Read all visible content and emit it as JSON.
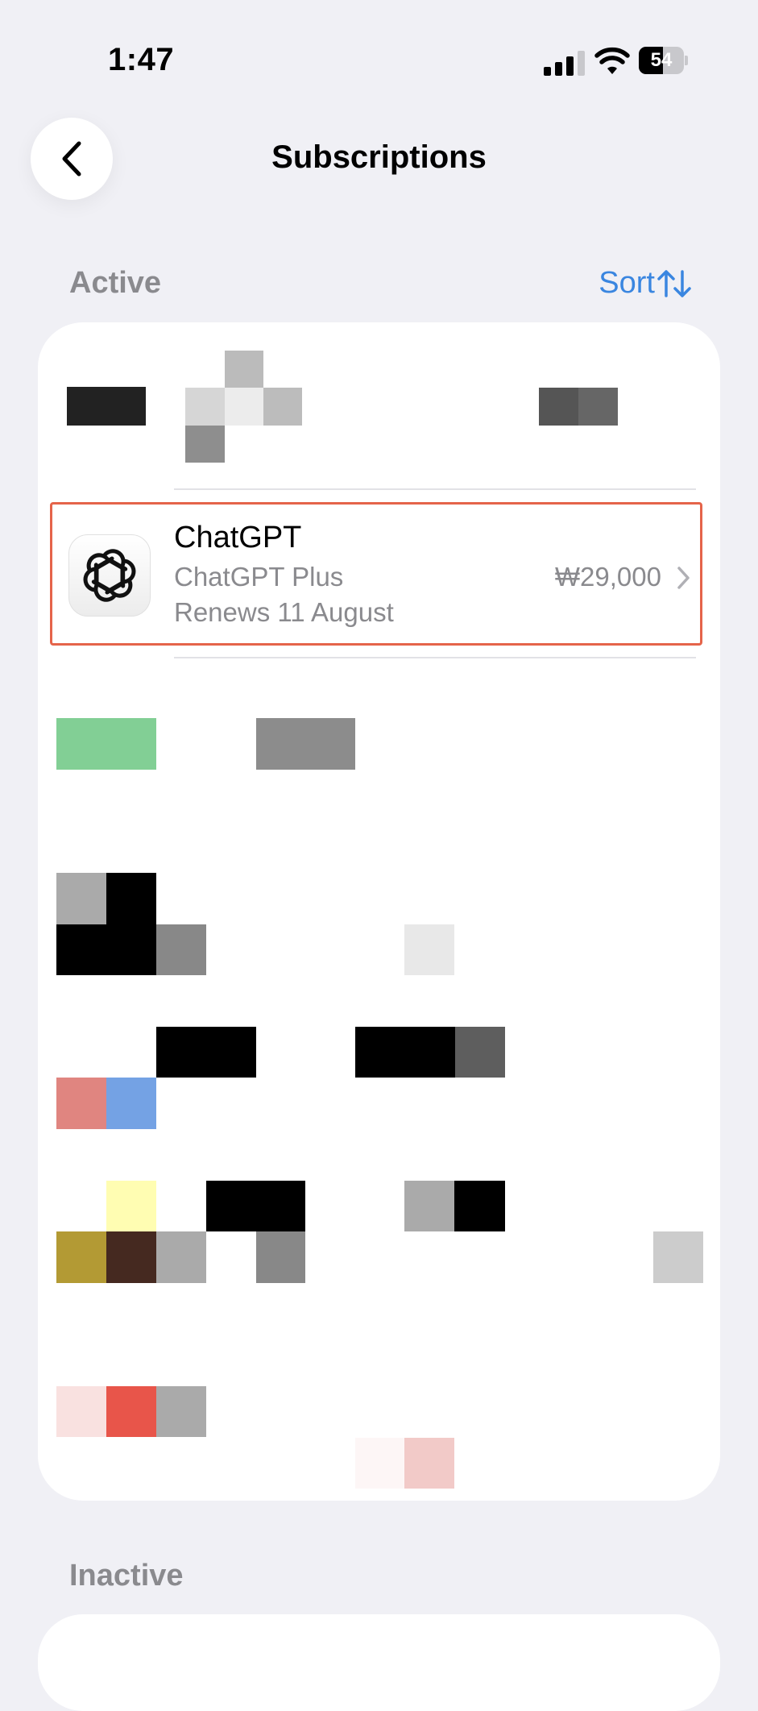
{
  "status_bar": {
    "time": "1:47",
    "battery": "54",
    "battery_level": 0.54
  },
  "nav": {
    "title": "Subscriptions"
  },
  "active_section": {
    "label": "Active",
    "sort_label": "Sort"
  },
  "subscriptions": [
    {
      "app": "ChatGPT",
      "plan": "ChatGPT Plus",
      "renews": "Renews 11 August",
      "price": "₩29,000",
      "icon": "openai-logo-icon"
    }
  ],
  "inactive_section": {
    "label": "Inactive"
  },
  "colors": {
    "accent": "#3a86e0",
    "highlight": "#e5644a",
    "background": "#f0f0f5"
  }
}
